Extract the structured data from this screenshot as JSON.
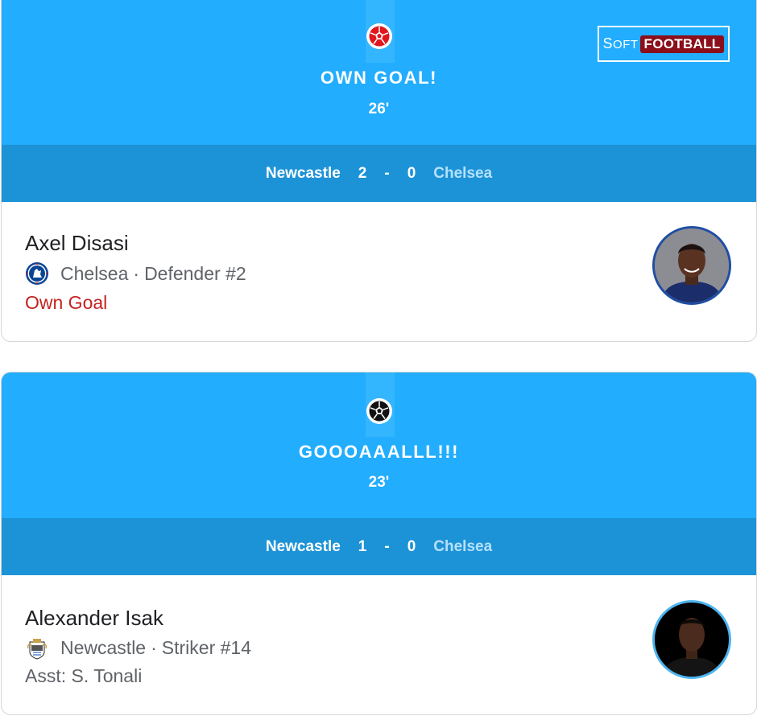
{
  "brand": {
    "soft_first": "S",
    "soft_rest": "OFT",
    "football": "FOOTBALL"
  },
  "events": [
    {
      "icon": "soccer-ball-red-icon",
      "title": "OWN GOAL!",
      "minute": "26'",
      "score": {
        "home_team": "Newcastle",
        "home_score": "2",
        "separator": "-",
        "away_score": "0",
        "away_team": "Chelsea"
      },
      "player": {
        "name": "Axel Disasi",
        "club": "Chelsea",
        "dot": "·",
        "role": "Defender #2",
        "crest": "chelsea-crest-icon",
        "detail": "Own Goal",
        "detail_color": "#c5221f",
        "avatar_ring": "#1f4ea3"
      }
    },
    {
      "icon": "soccer-ball-black-icon",
      "title": "GOOOAAALLL!!!",
      "minute": "23'",
      "score": {
        "home_team": "Newcastle",
        "home_score": "1",
        "separator": "-",
        "away_score": "0",
        "away_team": "Chelsea"
      },
      "player": {
        "name": "Alexander Isak",
        "club": "Newcastle",
        "dot": "·",
        "role": "Striker #14",
        "crest": "newcastle-crest-icon",
        "detail": "Asst: S. Tonali",
        "detail_color": "#5f6368",
        "avatar_ring": "#4cb4ef"
      }
    }
  ],
  "colors": {
    "hero_bg": "#22adfe",
    "scorebar_bg": "#1d93d7",
    "away_team_text": "#b5e1fb",
    "brand_red": "#8b0e1a"
  }
}
